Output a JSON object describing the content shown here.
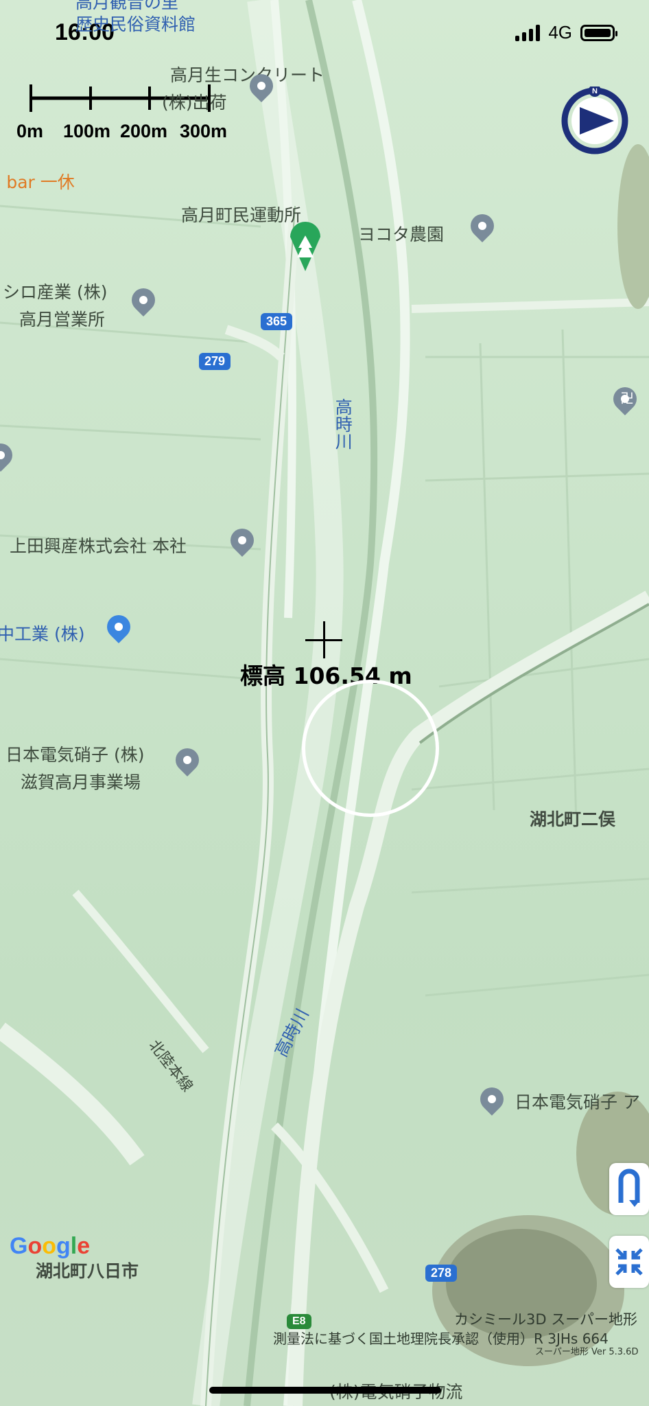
{
  "status": {
    "time": "16:00",
    "network": "4G"
  },
  "scale": {
    "labels": [
      "0m",
      "100m",
      "200m",
      "300m"
    ]
  },
  "elevation": {
    "text": "標高 106.54 m"
  },
  "places": {
    "top_museum_1": "高月観音の里",
    "top_museum_2": "歴史民俗資料館",
    "concrete_1": "高月生コンクリート",
    "concrete_2": "(株)出荷",
    "bar": "e bar 一休",
    "ground": "高月町民運動所",
    "yokota": "ヨコタ農園",
    "shiro_1": "シロ産業 (株)",
    "shiro_2": "高月営業所",
    "ueda": "上田興産株式会社 本社",
    "naka": "中工業 (株)",
    "neg_1": "日本電気硝子 (株)",
    "neg_2": "滋賀高月事業場",
    "kohoku_futamata": "湖北町二俣",
    "hokuriku": "北陸本線",
    "takatoki_1": "高時川",
    "takatoki_2": "高時川",
    "neg_right": "日本電気硝子 ア",
    "kohoku_yokaichi": "湖北町八日市",
    "bottom_logistics": "(株)電気硝子物流",
    "temple_symbol": "卍"
  },
  "routes": {
    "r365": "365",
    "r279": "279",
    "r278": "278",
    "e8": "E8"
  },
  "credits": {
    "line1": "カシミール3D スーパー地形",
    "line2": "測量法に基づく国土地理院長承認（使用）R 3JHs 664",
    "line3": "スーパー地形 Ver 5.3.6D"
  },
  "google_logo": "Google",
  "colors": {
    "map_bg": "#c9e3c9",
    "river_label": "#2f5fb0",
    "route_badge": "#2a6fd1",
    "compass": "#1d2f7a"
  }
}
